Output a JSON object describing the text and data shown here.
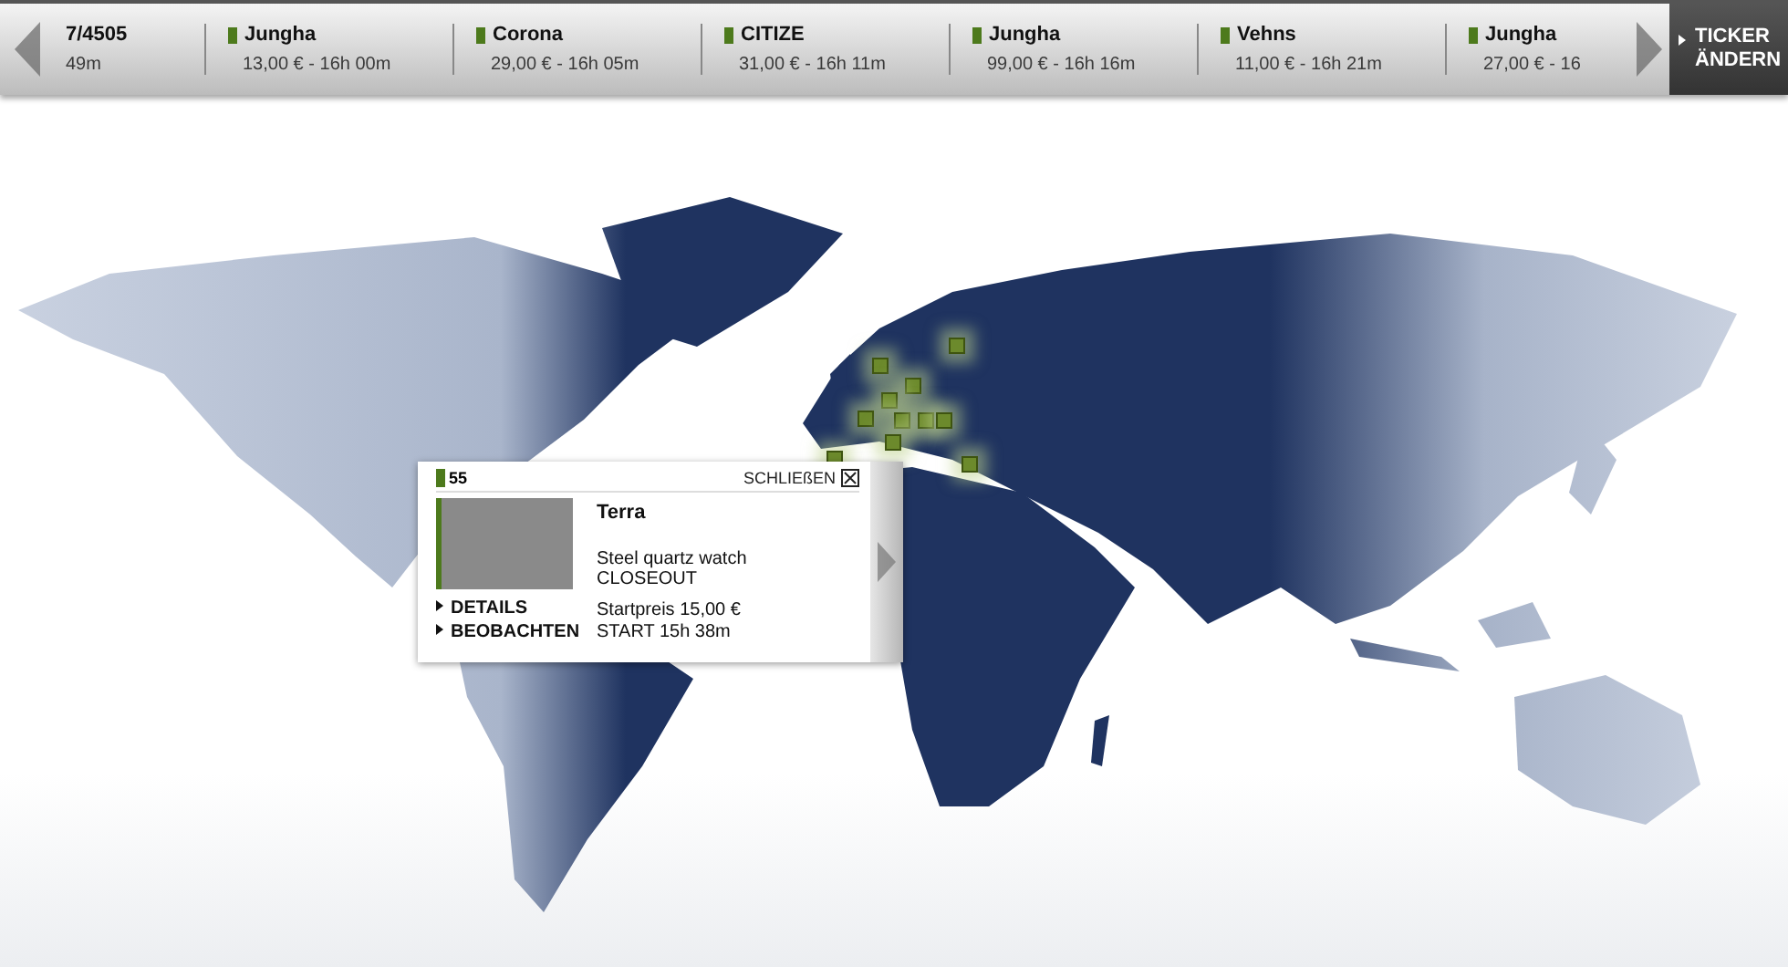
{
  "ticker": {
    "items": [
      {
        "title": "7/4505",
        "detail": "49m",
        "marker": false
      },
      {
        "title": "Jungha",
        "detail": "13,00 € - 16h 00m",
        "marker": true
      },
      {
        "title": "Corona",
        "detail": "29,00 € - 16h 05m",
        "marker": true
      },
      {
        "title": "CITIZE",
        "detail": "31,00 € - 16h 11m",
        "marker": true
      },
      {
        "title": "Jungha",
        "detail": "99,00 € - 16h 16m",
        "marker": true
      },
      {
        "title": "Vehns",
        "detail": "11,00 € - 16h 21m",
        "marker": true
      },
      {
        "title": "Jungha",
        "detail": "27,00 € - 16",
        "marker": true
      }
    ],
    "change_button": "TICKER ÄNDERN"
  },
  "popup": {
    "lot": "55",
    "close": "SCHLIEßEN",
    "title": "Terra",
    "description": "Steel quartz watch",
    "status": "CLOSEOUT",
    "links": [
      "DETAILS",
      "BEOBACHTEN"
    ],
    "price": "Startpreis 15,00 €",
    "start": "START 15h 38m"
  }
}
